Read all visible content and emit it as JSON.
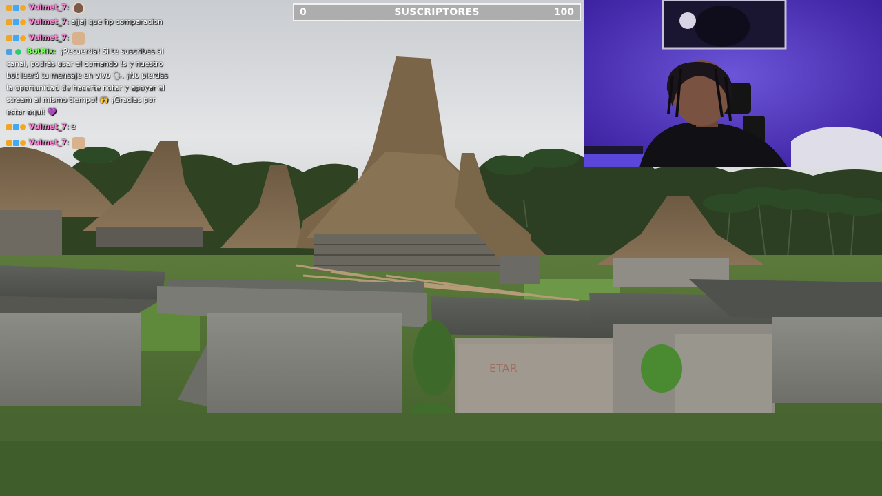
{
  "goal": {
    "min": "0",
    "title": "SUSCRIPTORES",
    "max": "100",
    "progress_fraction": 0.0,
    "fill_color": "#6f3cff"
  },
  "chat": {
    "messages": [
      {
        "badges": [
          "mod",
          "sub",
          "warn"
        ],
        "user": "Vulmet_7",
        "user_color": "#ff88d6",
        "text": "",
        "emote": "avatar-emote"
      },
      {
        "badges": [
          "mod",
          "sub",
          "warn"
        ],
        "user": "Vulmet_7",
        "user_color": "#ff88d6",
        "text": "ajjaj que hp comparacion",
        "emote": ""
      },
      {
        "badges": [
          "mod",
          "sub",
          "warn"
        ],
        "user": "Vulmet_7",
        "user_color": "#ff88d6",
        "text": "",
        "emote": "dog-emote"
      },
      {
        "badges": [
          "robot",
          "verified"
        ],
        "user": "BotRix",
        "user_color": "#7dff5c",
        "text": "¡Recuerda! Si te suscribes al canal, podrás usar el comando !s y nuestro bot leerá tu mensaje en vivo 🗣. ¡No pierdas la oportunidad de hacerte notar y apoyar el stream al mismo tiempo! 🙌 ¡Gracias por estar aquí! 💜",
        "emote": ""
      },
      {
        "badges": [
          "mod",
          "sub",
          "warn"
        ],
        "user": "Vulmet_7",
        "user_color": "#ff88d6",
        "text": "e",
        "emote": ""
      },
      {
        "badges": [
          "mod",
          "sub",
          "warn"
        ],
        "user": "Vulmet_7",
        "user_color": "#ff88d6",
        "text": "",
        "emote": "dog-emote"
      }
    ]
  },
  "colors": {
    "webcam_wall": "#4c2fb8",
    "goal_bar_bg": "#aaaaaa",
    "sky": "#d9dcdf",
    "grass": "#4f6b34"
  }
}
